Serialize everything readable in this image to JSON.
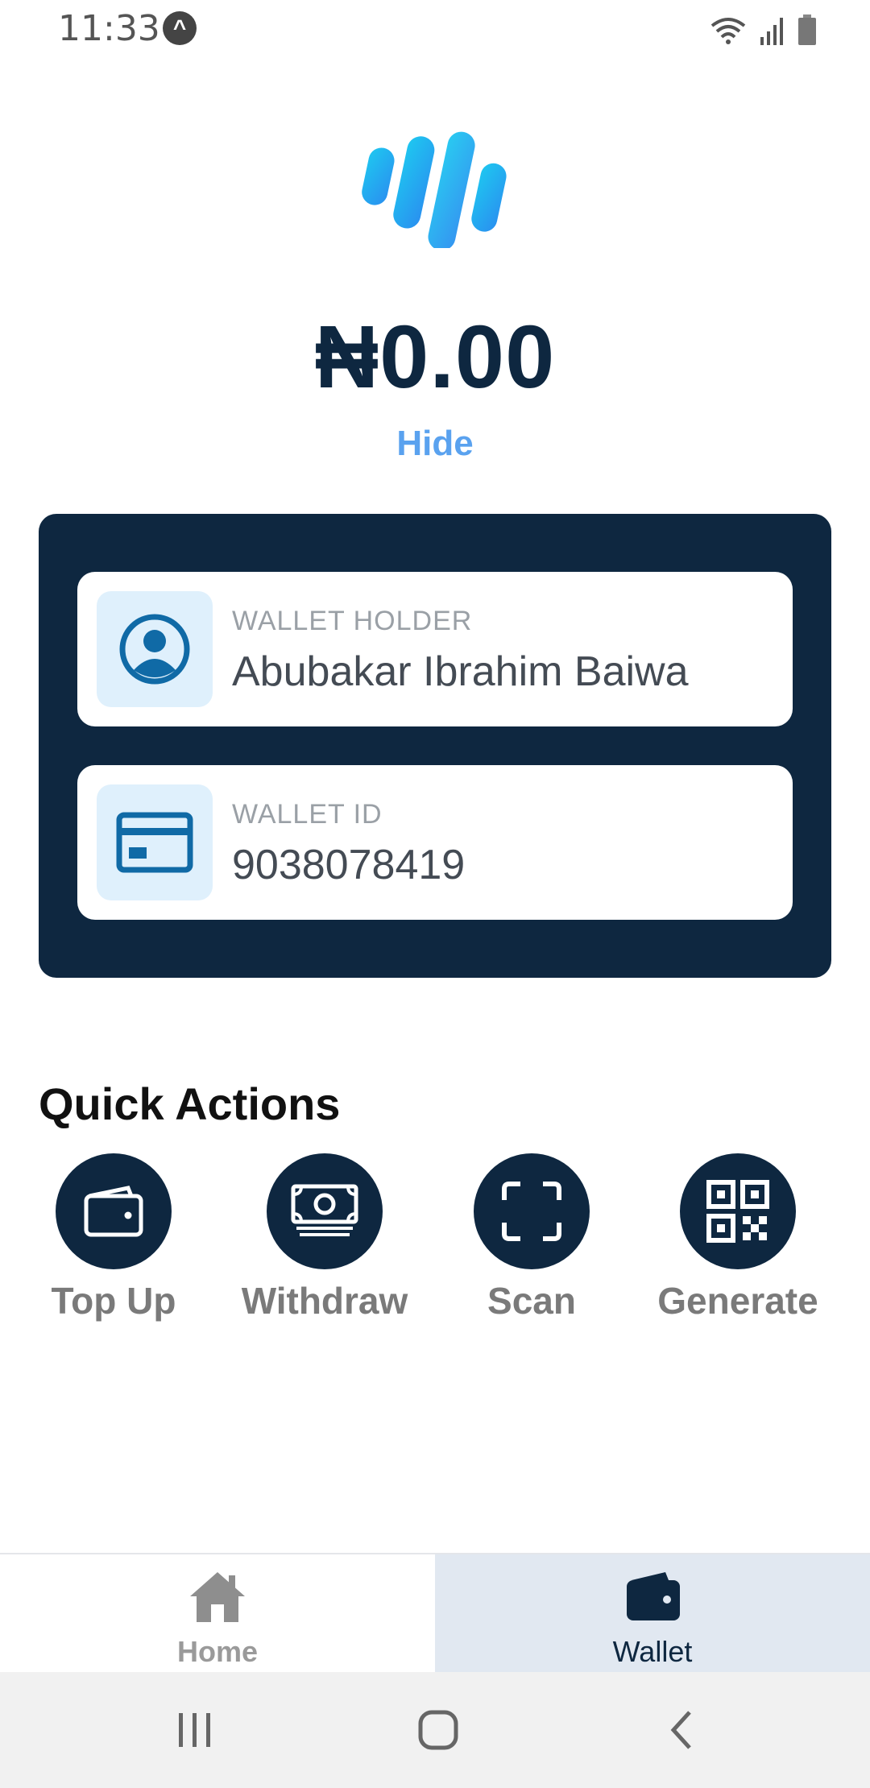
{
  "status_bar": {
    "time": "11:33"
  },
  "balance": {
    "amount": "₦0.00",
    "toggle_label": "Hide"
  },
  "wallet_holder": {
    "label": "WALLET HOLDER",
    "value": "Abubakar Ibrahim Baiwa"
  },
  "wallet_id": {
    "label": "WALLET ID",
    "value": "9038078419"
  },
  "quick_actions": {
    "title": "Quick Actions",
    "items": [
      {
        "label": "Top Up",
        "icon": "wallet-icon"
      },
      {
        "label": "Withdraw",
        "icon": "cash-icon"
      },
      {
        "label": "Scan",
        "icon": "scan-icon"
      },
      {
        "label": "Generate",
        "icon": "qr-code-icon"
      }
    ]
  },
  "bottom_nav": {
    "items": [
      {
        "label": "Home",
        "icon": "home-icon",
        "active": false
      },
      {
        "label": "Wallet",
        "icon": "wallet-icon",
        "active": true
      }
    ]
  },
  "colors": {
    "navy": "#0e2740",
    "accent_blue": "#5aa2ef",
    "icon_bg": "#dff0fc",
    "active_tab_bg": "#e1e8f1"
  }
}
